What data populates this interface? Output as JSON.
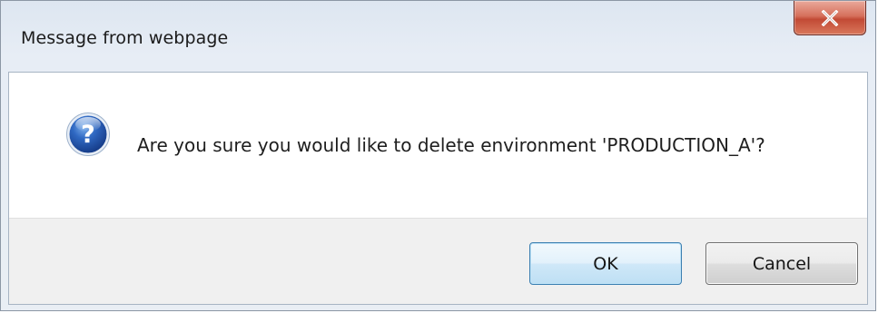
{
  "window": {
    "title": "Message from webpage",
    "close_icon": "close-x-icon"
  },
  "dialog": {
    "icon": "question-icon",
    "message": "Are you sure you would like to delete environment 'PRODUCTION_A'?"
  },
  "buttons": {
    "ok_label": "OK",
    "cancel_label": "Cancel"
  },
  "colors": {
    "titlebar": "#dde6f1",
    "close_button": "#c24a35",
    "ok_border": "#3c7fb1",
    "question_icon": "#2b5aa8",
    "button_bar": "#f0f0f0"
  }
}
